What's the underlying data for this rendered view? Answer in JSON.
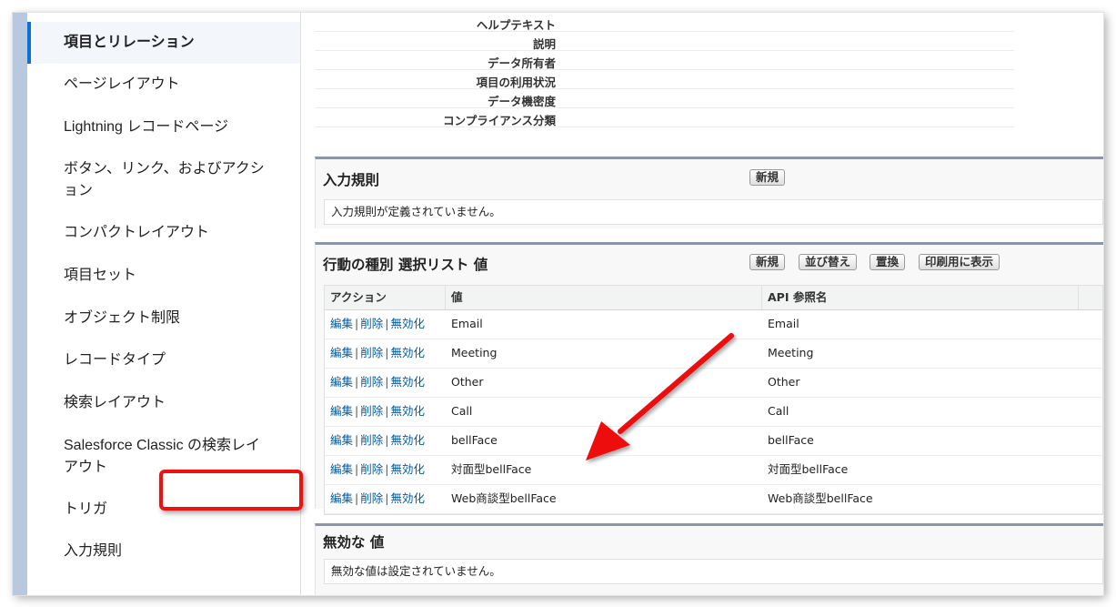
{
  "sidebar": {
    "items": [
      {
        "label": "項目とリレーション",
        "active": true
      },
      {
        "label": "ページレイアウト"
      },
      {
        "label": "Lightning レコードページ"
      },
      {
        "label": "ボタン、リンク、およびアクシ"
      },
      {
        "label": "ョン"
      },
      {
        "label": "コンパクトレイアウト"
      },
      {
        "label": "項目セット"
      },
      {
        "label": "オブジェクト制限"
      },
      {
        "label": "レコードタイプ"
      },
      {
        "label": "検索レイアウト"
      },
      {
        "label": "Salesforce Classic の検索レイ"
      },
      {
        "label": "アウト"
      },
      {
        "label": "トリガ"
      },
      {
        "label": "入力規則"
      }
    ]
  },
  "details": {
    "rows": [
      {
        "label": "ヘルプテキスト"
      },
      {
        "label": "説明"
      },
      {
        "label": "データ所有者"
      },
      {
        "label": "項目の利用状況"
      },
      {
        "label": "データ機密度"
      },
      {
        "label": "コンプライアンス分類"
      }
    ]
  },
  "validation": {
    "title": "入力規則",
    "new_label": "新規",
    "empty_message": "入力規則が定義されていません。"
  },
  "picklist": {
    "title": "行動の種別 選択リスト 値",
    "buttons": {
      "new": "新規",
      "reorder": "並び替え",
      "replace": "置換",
      "print": "印刷用に表示"
    },
    "columns": {
      "action": "アクション",
      "value": "値",
      "api": "API 参照名"
    },
    "action_links": {
      "edit": "編集",
      "delete": "削除",
      "deactivate": "無効化"
    },
    "separator": "|",
    "rows": [
      {
        "value": "Email",
        "api": "Email"
      },
      {
        "value": "Meeting",
        "api": "Meeting"
      },
      {
        "value": "Other",
        "api": "Other"
      },
      {
        "value": "Call",
        "api": "Call"
      },
      {
        "value": "bellFace",
        "api": "bellFace"
      },
      {
        "value": "対面型bellFace",
        "api": "対面型bellFace"
      },
      {
        "value": "Web商談型bellFace",
        "api": "Web商談型bellFace"
      }
    ]
  },
  "inactive": {
    "title": "無効な 値",
    "empty_message": "無効な値は設定されていません。"
  },
  "colors": {
    "link": "#015ba7",
    "accent": "#0d72cf",
    "annotation": "#ee1111"
  }
}
